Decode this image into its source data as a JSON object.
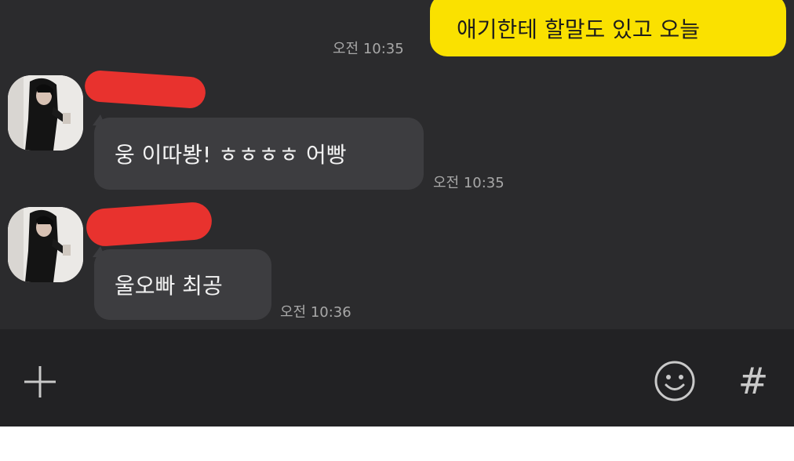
{
  "messages": [
    {
      "direction": "outgoing",
      "text": "애기한테 할말도 있고 오늘",
      "time": "오전 10:35"
    },
    {
      "direction": "incoming",
      "text": "웅 이따봥! ㅎㅎㅎㅎ 어빵",
      "time": "오전 10:35"
    },
    {
      "direction": "incoming",
      "text": "울오빠 최공",
      "time": "오전 10:36"
    }
  ],
  "input_bar": {
    "plus_icon": "plus-icon",
    "emoji_icon": "smiley-icon",
    "hash_icon": "hash-icon",
    "hash_glyph": "#"
  },
  "colors": {
    "chat_bg": "#2b2b2d",
    "outgoing_bubble": "#fae100",
    "incoming_bubble": "#3d3d40",
    "redaction": "#e8322e",
    "input_bg": "#222224"
  }
}
